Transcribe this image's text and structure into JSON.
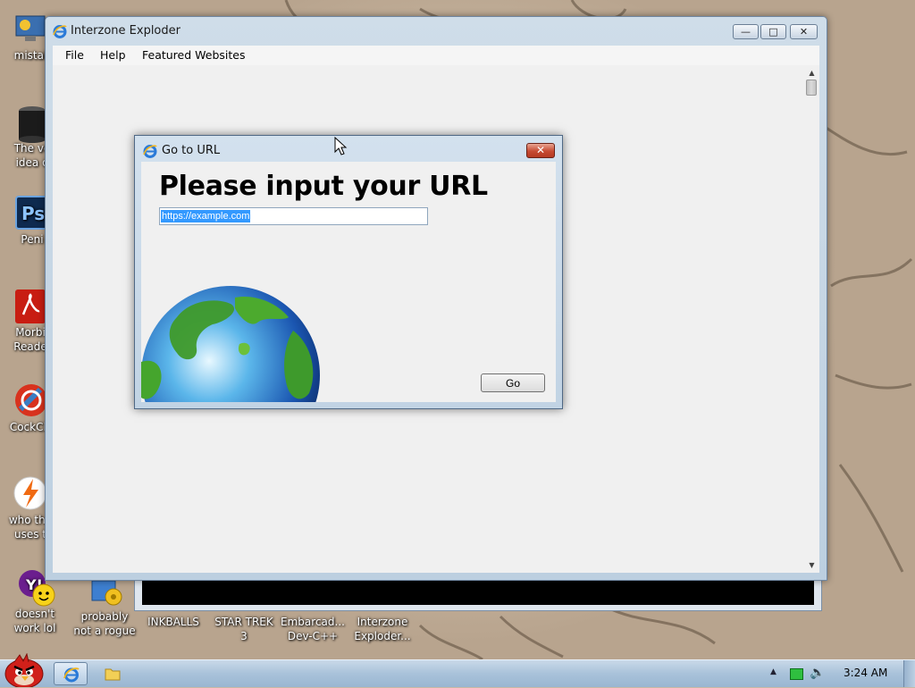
{
  "desktop": {
    "icons": [
      {
        "label": "mistal"
      },
      {
        "label": "The ve\nidea o"
      },
      {
        "label": "Peni"
      },
      {
        "label": "Morbi\nReade"
      },
      {
        "label": "CockCle"
      },
      {
        "label": "who the\nuses t"
      },
      {
        "label": "doesn't\nwork lol"
      },
      {
        "label": "probably\nnot a rogue"
      },
      {
        "label": "INKBALLS"
      },
      {
        "label": "STAR TREK\n3"
      },
      {
        "label": "Embarcad...\nDev-C++"
      },
      {
        "label": "Interzone\nExploder..."
      }
    ]
  },
  "main_window": {
    "title": "Interzone Exploder",
    "menu": {
      "file": "File",
      "help": "Help",
      "featured": "Featured Websites"
    },
    "caption": {
      "minimize": "—",
      "maximize": "□",
      "close": "✕"
    },
    "scroll": {
      "up": "▲",
      "down": "▼"
    }
  },
  "dialog": {
    "title": "Go to URL",
    "close": "✕",
    "heading": "Please input your URL",
    "url_value": "https://example.com",
    "go_label": "Go"
  },
  "taskbar": {
    "clock": "3:24 AM",
    "tray_arrow": "▲",
    "volume_icon": "🔈"
  },
  "icons": {
    "app": "ie-icon",
    "globe": "globe-icon",
    "start": "angry-bird-start-icon"
  },
  "colors": {
    "selection": "#3399ff",
    "dialog_close": "#c64a32",
    "network_tray": "#2fbf3f"
  }
}
